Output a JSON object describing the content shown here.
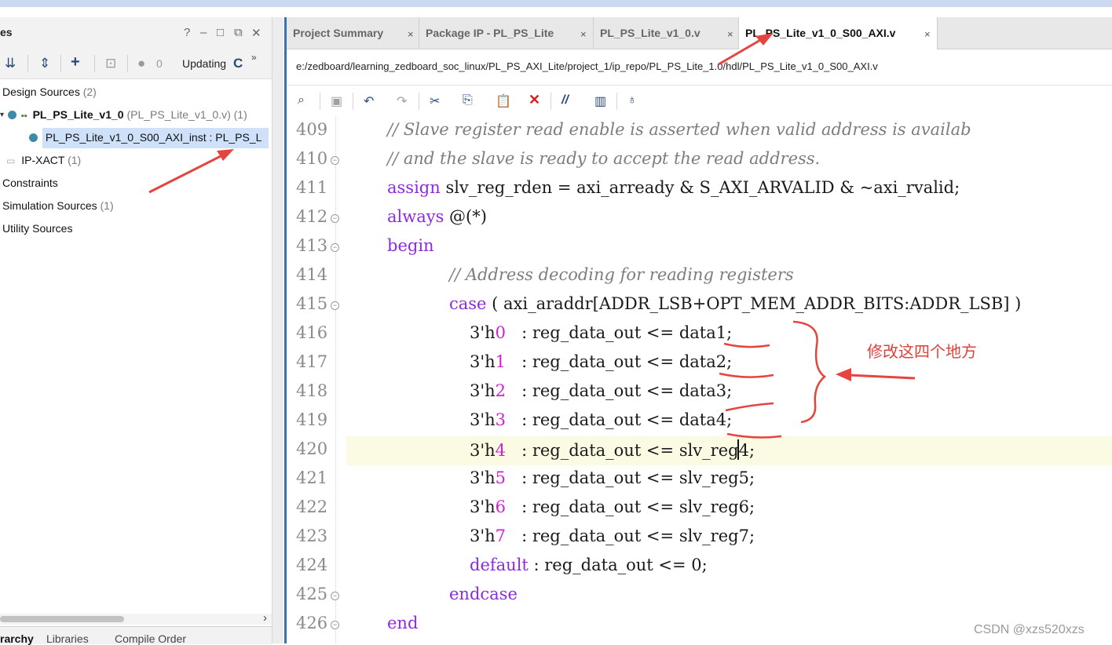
{
  "left_panel": {
    "title": "es",
    "header_icons": [
      "help-icon",
      "minimize-icon",
      "restore-icon",
      "float-icon",
      "close-icon"
    ],
    "toolbar": {
      "count": "0",
      "status": "Updating",
      "more": "»"
    },
    "tree": {
      "design_sources": {
        "label": "Design Sources",
        "count": "(2)"
      },
      "top_module": {
        "name": "PL_PS_Lite_v1_0",
        "detail": "(PL_PS_Lite_v1_0.v) (1)"
      },
      "instance": {
        "name": "PL_PS_Lite_v1_0_S00_AXI_inst : PL_PS_L"
      },
      "ip_xact": {
        "label": "IP-XACT",
        "count": "(1)"
      },
      "constraints": {
        "label": "Constraints"
      },
      "simulation": {
        "label": "Simulation Sources",
        "count": "(1)"
      },
      "utility": {
        "label": "Utility Sources"
      }
    },
    "bottom_tabs": [
      "rarchy",
      "Libraries",
      "Compile Order"
    ]
  },
  "editor": {
    "tabs": [
      {
        "label": "Project Summary",
        "active": false
      },
      {
        "label": "Package IP - PL_PS_Lite",
        "active": false
      },
      {
        "label": "PL_PS_Lite_v1_0.v",
        "active": false
      },
      {
        "label": "PL_PS_Lite_v1_0_S00_AXI.v",
        "active": true
      }
    ],
    "close_glyph": "×",
    "path": "e:/zedboard/learning_zedboard_soc_linux/PL_PS_AXI_Lite/project_1/ip_repo/PL_PS_Lite_1.0/hdl/PL_PS_Lite_v1_0_S00_AXI.v",
    "toolbar_icons": [
      "search-icon",
      "save-icon",
      "undo-icon",
      "redo-icon",
      "cut-icon",
      "copy-icon",
      "paste-icon",
      "delete-icon",
      "comment-icon",
      "columns-icon",
      "bulb-icon"
    ],
    "line_numbers": [
      "409",
      "410",
      "411",
      "412",
      "413",
      "414",
      "415",
      "416",
      "417",
      "418",
      "419",
      "420",
      "421",
      "422",
      "423",
      "424",
      "425",
      "426"
    ],
    "code": {
      "l409": "// Slave register read enable is asserted when valid address is availab",
      "l410": "// and the slave is ready to accept the read address.",
      "l411_kw": "assign",
      "l411_rest": " slv_reg_rden = axi_arready & S_AXI_ARVALID & ~axi_rvalid;",
      "l412_kw": "always",
      "l412_rest": " @(*)",
      "l413_kw": "begin",
      "l414": "// Address decoding for reading registers",
      "l415_kw": "case",
      "l415_rest": " ( axi_araddr[ADDR_LSB+OPT_MEM_ADDR_BITS:ADDR_LSB] )",
      "prefix": "3'h",
      "mid": "   : reg_data_out <= ",
      "rows": [
        {
          "num": "0",
          "target": "data1;"
        },
        {
          "num": "1",
          "target": "data2;"
        },
        {
          "num": "2",
          "target": "data3;"
        },
        {
          "num": "3",
          "target": "data4;"
        },
        {
          "num": "4",
          "target_a": "slv_reg",
          "target_b": "4;"
        },
        {
          "num": "5",
          "target": "slv_reg5;"
        },
        {
          "num": "6",
          "target": "slv_reg6;"
        },
        {
          "num": "7",
          "target": "slv_reg7;"
        }
      ],
      "l424_kw": "default",
      "l424_rest": " : reg_data_out <= 0;",
      "l425_kw": "endcase",
      "l426_kw": "end"
    }
  },
  "annotation": {
    "text": "修改这四个地方",
    "color": "#e0403a"
  },
  "watermark": "CSDN @xzs520xzs",
  "colors": {
    "accent": "#3d6fb6",
    "keyword": "#8a2be2",
    "number": "#d21fd2",
    "comment": "#7d7d7d",
    "highlight": "#fbfbe3",
    "selection": "#cfe0fa"
  }
}
